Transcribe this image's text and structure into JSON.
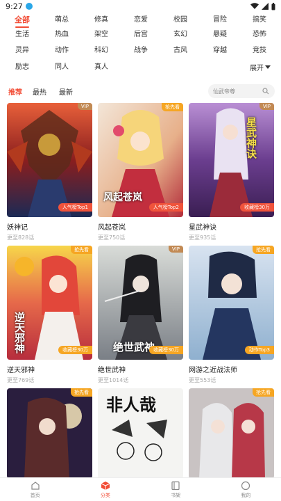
{
  "status": {
    "time": "9:27"
  },
  "genres": [
    "全部",
    "萌总",
    "修真",
    "恋爱",
    "校园",
    "冒险",
    "搞笑",
    "生活",
    "热血",
    "架空",
    "后宫",
    "玄幻",
    "悬疑",
    "恐怖",
    "灵异",
    "动作",
    "科幻",
    "战争",
    "古风",
    "穿越",
    "竞技",
    "励志",
    "同人",
    "真人"
  ],
  "expand_label": "展开",
  "sort_tabs": [
    "推荐",
    "最热",
    "最新"
  ],
  "search_placeholder": "仙武帝尊",
  "cards": [
    {
      "title": "妖神记",
      "sub": "更至828话",
      "corner": "VIP",
      "rank": "人气榜Top1"
    },
    {
      "title": "风起苍岚",
      "sub": "更至750话",
      "corner": "抢先看",
      "rank": "人气榜Top2",
      "cover_text": "风起苍岚"
    },
    {
      "title": "星武神诀",
      "sub": "更至935话",
      "corner": "VIP",
      "rank": "收藏榜30万",
      "cover_text": "星武神诀"
    },
    {
      "title": "逆天邪神",
      "sub": "更至769话",
      "corner": "抢先看",
      "rank": "收藏榜30万",
      "cover_text": "逆天邪神"
    },
    {
      "title": "绝世武神",
      "sub": "更至1014话",
      "corner": "VIP",
      "rank": "收藏榜30万",
      "cover_text": "绝世武神"
    },
    {
      "title": "网游之近战法师",
      "sub": "更至553话",
      "corner": "抢先看",
      "rank": "动作Top3"
    },
    {
      "title": "",
      "sub": "",
      "corner": "抢先看",
      "rank": ""
    },
    {
      "title": "",
      "sub": "",
      "corner": "",
      "rank": "",
      "cover_text": "非人哉"
    },
    {
      "title": "",
      "sub": "",
      "corner": "抢先看",
      "rank": ""
    }
  ],
  "nav": [
    "首页",
    "分类",
    "书架",
    "我的"
  ],
  "colors": {
    "accent": "#f24c35",
    "vip": "#c28a54",
    "first_look": "#f6a623"
  }
}
